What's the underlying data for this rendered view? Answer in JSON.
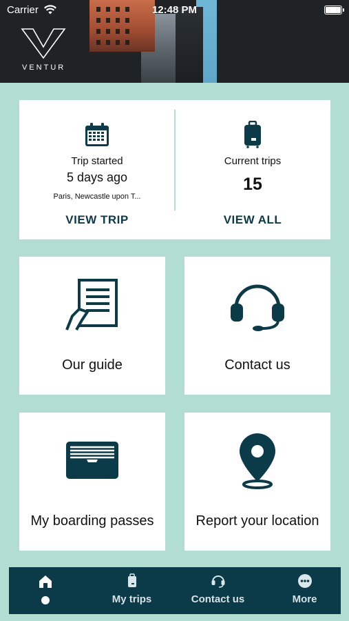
{
  "status_bar": {
    "carrier": "Carrier",
    "time": "12:48 PM"
  },
  "brand": {
    "logo_text": "VENTUR"
  },
  "trip_summary": {
    "trip_started_label": "Trip started",
    "trip_started_value": "5 days ago",
    "trip_locations": "Paris, Newcastle upon T...",
    "view_trip_label": "VIEW TRIP",
    "current_trips_label": "Current trips",
    "current_trips_count": "15",
    "view_all_label": "VIEW ALL"
  },
  "tiles": [
    {
      "label": "Our guide",
      "icon": "guide-icon"
    },
    {
      "label": "Contact us",
      "icon": "headset-icon"
    },
    {
      "label": "My boarding passes",
      "icon": "boarding-pass-icon"
    },
    {
      "label": "Report your location",
      "icon": "location-pin-icon"
    }
  ],
  "nav": [
    {
      "label": "",
      "icon": "home-icon",
      "active": true
    },
    {
      "label": "My trips",
      "icon": "luggage-icon"
    },
    {
      "label": "Contact us",
      "icon": "headset-icon"
    },
    {
      "label": "More",
      "icon": "more-icon"
    }
  ],
  "colors": {
    "background": "#b2ddd3",
    "primary": "#0b3a48",
    "card": "#ffffff"
  }
}
